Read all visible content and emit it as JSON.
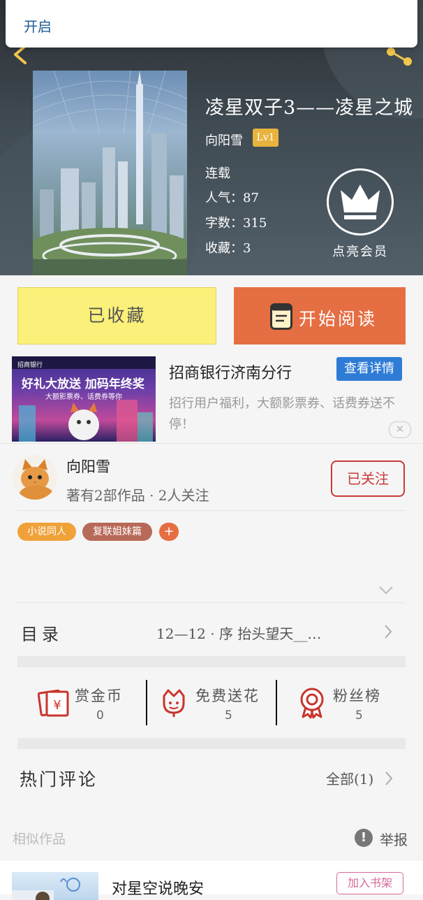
{
  "notification": {
    "label": "开启"
  },
  "book": {
    "title": "凌星双子3——凌星之城",
    "author": "向阳雪",
    "level": "Lv1",
    "status": "连载",
    "popularity": "人气：87",
    "word_count": "字数：315",
    "favorites": "收藏：3"
  },
  "vip": {
    "label": "点亮会员"
  },
  "actions": {
    "collected_label": "已收藏",
    "read_label": "开始阅读"
  },
  "ad": {
    "image_bank_label": "招商银行",
    "image_slogan": "好礼大放送 加码年终奖",
    "image_subslogan": "大额影票券、话费券等你",
    "title": "招商银行济南分行",
    "detail_button": "查看详情",
    "description": "招行用户福利，大额影票券、话费券送不停！",
    "close_glyph": "✕"
  },
  "author_info": {
    "name": "向阳雪",
    "meta": "著有2部作品 · 2人关注",
    "follow_label": "已关注"
  },
  "tags": [
    {
      "label": "小说同人",
      "color": "#f0a23a"
    },
    {
      "label": "复联姐妹篇",
      "color": "#b86a58"
    }
  ],
  "tag_add": "+",
  "toc": {
    "label": "目录",
    "latest": "12—12  ·  序 抬头望天__…"
  },
  "stats": [
    {
      "label": "赏金币",
      "value": "0",
      "icon": "coin-envelope-icon"
    },
    {
      "label": "免费送花",
      "value": "5",
      "icon": "flower-icon"
    },
    {
      "label": "粉丝榜",
      "value": "5",
      "icon": "medal-icon"
    }
  ],
  "comments": {
    "title": "热门评论",
    "all_label": "全部(1)"
  },
  "similar": {
    "section_label": "相似作品",
    "report_glyph": "!",
    "report_label": "举报",
    "items": [
      {
        "title": "对星空说晚安",
        "add_label": "加入书架"
      }
    ]
  },
  "colors": {
    "accent_orange": "#e66e43",
    "collected_yellow": "#fbf07a",
    "follow_red": "#c93a3a",
    "ad_blue": "#2f7cd6"
  }
}
